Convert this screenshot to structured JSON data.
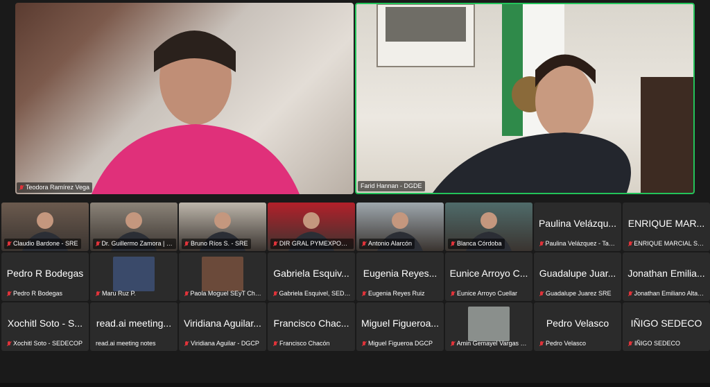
{
  "speakers": [
    {
      "name": "Teodora Ramírez Vega",
      "muted": true
    },
    {
      "name": "Farid Hannan - DGDE",
      "muted": false
    }
  ],
  "tiles": [
    {
      "label": "Claudio Bardone - SRE",
      "big": "",
      "video": true,
      "bg": "#6b5a4e"
    },
    {
      "label": "Dr. Guillermo Zamora | DG...",
      "big": "",
      "video": true,
      "bg": "#8b8378"
    },
    {
      "label": "Bruno Ríos S. - SRE",
      "big": "",
      "video": true,
      "bg": "#bdb6ab"
    },
    {
      "label": "DIR GRAL PYMEXPORTA",
      "big": "",
      "video": true,
      "bg": "#b3202a"
    },
    {
      "label": "Antonio Alarcón",
      "big": "",
      "video": true,
      "bg": "#9ea7ad"
    },
    {
      "label": "Blanca Córdoba",
      "big": "",
      "video": true,
      "bg": "#4f6b6a"
    },
    {
      "label": "Paulina Velázquez - Tabas...",
      "big": "Paulina Velázqu...",
      "video": false
    },
    {
      "label": "ENRIQUE MARCIAL SEDE...",
      "big": "ENRIQUE MAR...",
      "video": false
    },
    {
      "label": "Pedro R Bodegas",
      "big": "Pedro R Bodegas",
      "video": false
    },
    {
      "label": "Maru Ruz P.",
      "big": "",
      "video": false,
      "thumb": "#3a4a6a"
    },
    {
      "label": "Paola Moguel SEyT Chiapas",
      "big": "",
      "video": false,
      "thumb": "#6b4a3a"
    },
    {
      "label": "Gabriela Esquivel, SEDEC...",
      "big": "Gabriela Esquiv...",
      "video": false
    },
    {
      "label": "Eugenia Reyes Ruiz",
      "big": "Eugenia Reyes...",
      "video": false
    },
    {
      "label": "Eunice Arroyo Cuellar",
      "big": "Eunice Arroyo C...",
      "video": false
    },
    {
      "label": "Guadalupe Juarez SRE",
      "big": "Guadalupe Juar...",
      "video": false
    },
    {
      "label": "Jonathan Emiliano Altamir...",
      "big": "Jonathan Emilia...",
      "video": false
    },
    {
      "label": "Xochitl Soto - SEDECOP",
      "big": "Xochitl Soto - S...",
      "video": false
    },
    {
      "label": "read.ai meeting notes",
      "big": "read.ai meeting...",
      "video": false,
      "nomic": true
    },
    {
      "label": "Viridiana Aguilar - DGCP",
      "big": "Viridiana Aguilar...",
      "video": false
    },
    {
      "label": "Francisco Chacón",
      "big": "Francisco Chac...",
      "video": false
    },
    {
      "label": "Miguel Figueroa DGCP",
      "big": "Miguel Figueroa...",
      "video": false
    },
    {
      "label": "Amin Gemayel Vargas Díaz",
      "big": "",
      "video": false,
      "thumb": "#8a8f8c"
    },
    {
      "label": "Pedro Velasco",
      "big": "Pedro Velasco",
      "video": false
    },
    {
      "label": "IÑIGO SEDECO",
      "big": "IÑIGO SEDECO",
      "video": false
    }
  ],
  "colors": {
    "active_speaker_border": "#23c45a",
    "mic_muted": "#e0333a"
  }
}
